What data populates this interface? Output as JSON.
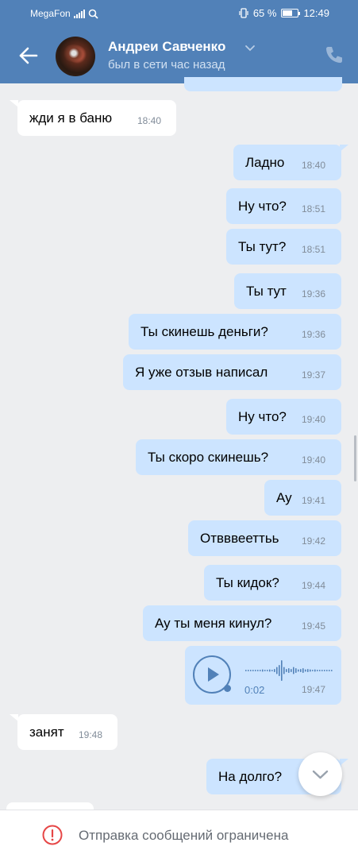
{
  "status_bar": {
    "carrier": "MegaFon",
    "battery": "65 %",
    "battery_level": 0.65,
    "time": "12:49"
  },
  "header": {
    "contact_name": "Андреи Савченко",
    "last_seen": "был в сети час назад"
  },
  "messages": [
    {
      "dir": "in",
      "text": "жди я в баню",
      "time": "18:40"
    },
    {
      "dir": "out",
      "text": "Ладно",
      "time": "18:40"
    },
    {
      "dir": "out",
      "text": "Ну что?",
      "time": "18:51"
    },
    {
      "dir": "out",
      "text": "Ты тут?",
      "time": "18:51"
    },
    {
      "dir": "out",
      "text": "Ты тут",
      "time": "19:36"
    },
    {
      "dir": "out",
      "text": "Ты скинешь деньги?",
      "time": "19:36"
    },
    {
      "dir": "out",
      "text": "Я уже отзыв написал",
      "time": "19:37"
    },
    {
      "dir": "out",
      "text": "Ну что?",
      "time": "19:40"
    },
    {
      "dir": "out",
      "text": "Ты скоро скинешь?",
      "time": "19:40"
    },
    {
      "dir": "out",
      "text": "Ау",
      "time": "19:41"
    },
    {
      "dir": "out",
      "text": "Отвввееттьь",
      "time": "19:42"
    },
    {
      "dir": "out",
      "text": "Ты кидок?",
      "time": "19:44"
    },
    {
      "dir": "out",
      "text": "Ау ты меня кинул?",
      "time": "19:45"
    },
    {
      "dir": "out",
      "voice": true,
      "duration": "0:02",
      "time": "19:47"
    },
    {
      "dir": "in",
      "text": "занят",
      "time": "19:48"
    },
    {
      "dir": "out",
      "text": "На долго?",
      "time": ""
    }
  ],
  "footer": {
    "restriction_text": "Отправка сообщений ограничена"
  },
  "colors": {
    "header": "#5181b8",
    "outgoing_bubble": "#cce4ff",
    "incoming_bubble": "#ffffff",
    "background": "#edeef0",
    "restriction_icon": "#e64646"
  },
  "icons": [
    "back-arrow-icon",
    "chevron-down-icon",
    "phone-icon",
    "play-icon",
    "chevron-down-icon",
    "exclamation-circle-icon"
  ]
}
